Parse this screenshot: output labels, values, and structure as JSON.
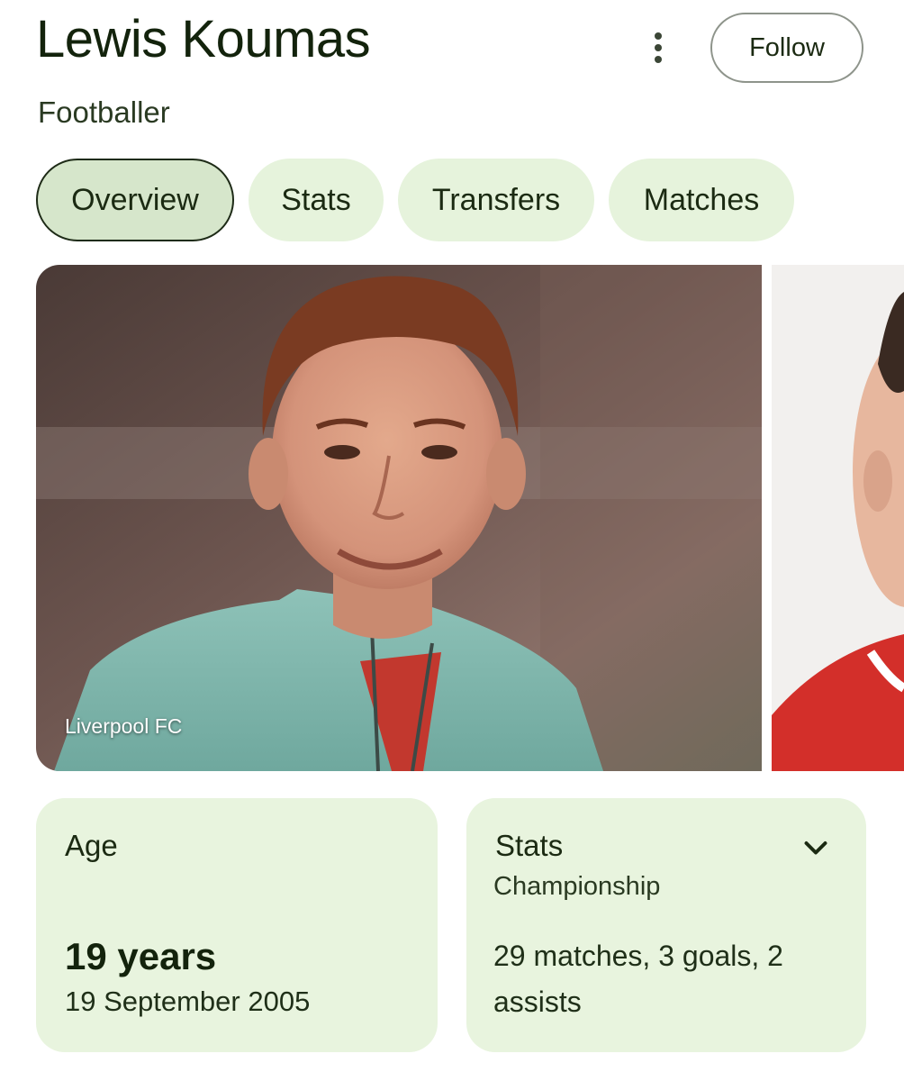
{
  "header": {
    "title": "Lewis Koumas",
    "subtitle": "Footballer",
    "more_icon": "more-vertical-icon",
    "follow_label": "Follow"
  },
  "tabs": [
    {
      "label": "Overview",
      "active": true
    },
    {
      "label": "Stats",
      "active": false
    },
    {
      "label": "Transfers",
      "active": false
    },
    {
      "label": "Matches",
      "active": false
    }
  ],
  "gallery": {
    "main_caption": "Liverpool FC"
  },
  "age_card": {
    "label": "Age",
    "value": "19 years",
    "birth_date": "19 September 2005"
  },
  "stats_card": {
    "label": "Stats",
    "competition": "Championship",
    "summary": "29 matches, 3 goals, 2 assists",
    "expand_icon": "chevron-down-icon"
  },
  "colors": {
    "chip_background": "#e6f3dc",
    "chip_active_background": "#d6e6cb",
    "card_background": "#e8f4de",
    "text_primary": "#13230c"
  }
}
